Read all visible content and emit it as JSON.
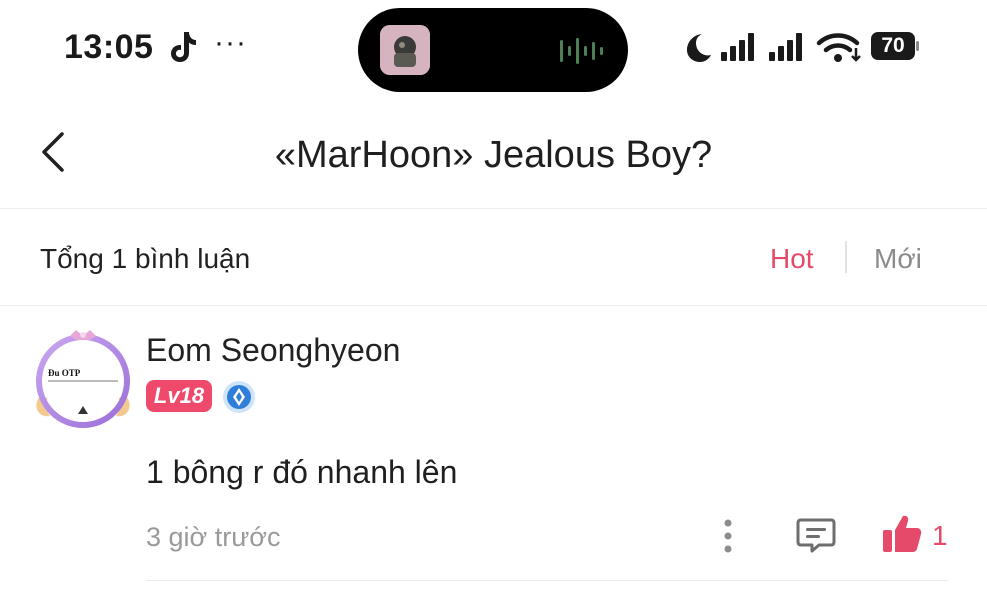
{
  "status_bar": {
    "time": "13:05",
    "overflow": "···",
    "battery": "70",
    "icons": [
      "tiktok-icon",
      "moon-icon",
      "signal-icon",
      "signal-icon",
      "wifi-icon",
      "battery-icon"
    ]
  },
  "header": {
    "title": "«MarHoon» Jealous Boy?",
    "back_icon": "chevron-left-icon"
  },
  "summary": {
    "count_label": "Tổng 1 bình luận",
    "sort_options": [
      "Hot",
      "Mới"
    ],
    "active_sort": "Hot"
  },
  "comments": [
    {
      "username": "Eom Seonghyeon",
      "level": "Lv18",
      "avatar_text": "Đu OTP",
      "content": "1 bông r đó nhanh lên",
      "time_ago": "3 giờ trước",
      "likes": "1"
    }
  ],
  "colors": {
    "accent": "#e64a6a",
    "level_badge": "#ef4a6b",
    "muted_text": "#9a9a9a"
  }
}
